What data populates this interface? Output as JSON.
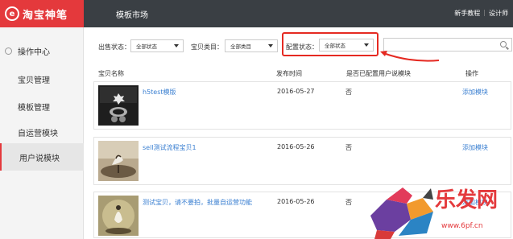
{
  "header": {
    "logo_text": "淘宝神笔",
    "logo_icon": "e",
    "page_title": "模板市场",
    "links": [
      "新手教程",
      "设计师"
    ],
    "link_separator": "|"
  },
  "sidebar": {
    "items": [
      {
        "label": "操作中心",
        "icon": "circle-icon"
      },
      {
        "label": "宝贝管理"
      },
      {
        "label": "模板管理"
      },
      {
        "label": "自运营模块"
      },
      {
        "label": "用户说模块",
        "active": true
      }
    ]
  },
  "filters": {
    "sale_status_label": "出售状态：",
    "sale_status_value": "全部状态",
    "category_label": "宝贝类目：",
    "category_value": "全部类目",
    "config_status_label": "配置状态：",
    "config_status_value": "全部状态",
    "search_placeholder": ""
  },
  "table": {
    "columns": [
      "宝贝名称",
      "发布时间",
      "是否已配置用户说模块",
      "操作"
    ],
    "rows": [
      {
        "name": "h5test模版",
        "date": "2016-05-27",
        "configured": "否",
        "action": "添加模块"
      },
      {
        "name": "sell测试流程宝贝1",
        "date": "2016-05-26",
        "configured": "否",
        "action": "添加模块"
      },
      {
        "name": "测试宝贝，请不要拍，批量自运营功能",
        "date": "2016-05-26",
        "configured": "否",
        "action": "添加模块"
      }
    ]
  },
  "watermark": {
    "text": "乐发网",
    "url": "www.6pf.cn"
  },
  "colors": {
    "brand_red": "#e4393c",
    "topbar": "#3a3f44",
    "link_blue": "#3a7fd1",
    "highlight_red": "#e52a22"
  }
}
